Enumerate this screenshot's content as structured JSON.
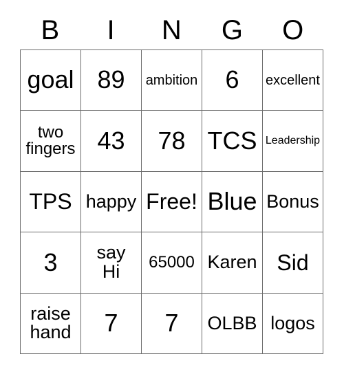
{
  "card": {
    "title": "BINGO",
    "headers": [
      "B",
      "I",
      "N",
      "G",
      "O"
    ],
    "free_space_label": "Free!",
    "colors": {
      "background": "#ffffff",
      "border": "#6b6b6b",
      "text": "#000000"
    },
    "rows": [
      [
        {
          "text": "goal",
          "size": "xl"
        },
        {
          "text": "89",
          "size": "xl"
        },
        {
          "text": "ambition",
          "size": "xs"
        },
        {
          "text": "6",
          "size": "xl"
        },
        {
          "text": "excellent",
          "size": "xs"
        }
      ],
      [
        {
          "text": "two\nfingers",
          "size": "sm"
        },
        {
          "text": "43",
          "size": "xl"
        },
        {
          "text": "78",
          "size": "xl"
        },
        {
          "text": "TCS",
          "size": "xl"
        },
        {
          "text": "Leadership",
          "size": "xxs"
        }
      ],
      [
        {
          "text": "TPS",
          "size": "lg"
        },
        {
          "text": "happy",
          "size": "md"
        },
        {
          "text": "Free!",
          "size": "lg"
        },
        {
          "text": "Blue",
          "size": "xl"
        },
        {
          "text": "Bonus",
          "size": "md"
        }
      ],
      [
        {
          "text": "3",
          "size": "xl"
        },
        {
          "text": "say\nHi",
          "size": "md"
        },
        {
          "text": "65000",
          "size": "sm"
        },
        {
          "text": "Karen",
          "size": "md"
        },
        {
          "text": "Sid",
          "size": "lg"
        }
      ],
      [
        {
          "text": "raise\nhand",
          "size": "md"
        },
        {
          "text": "7",
          "size": "xl"
        },
        {
          "text": "7",
          "size": "xl"
        },
        {
          "text": "OLBB",
          "size": "md"
        },
        {
          "text": "logos",
          "size": "md"
        }
      ]
    ]
  }
}
